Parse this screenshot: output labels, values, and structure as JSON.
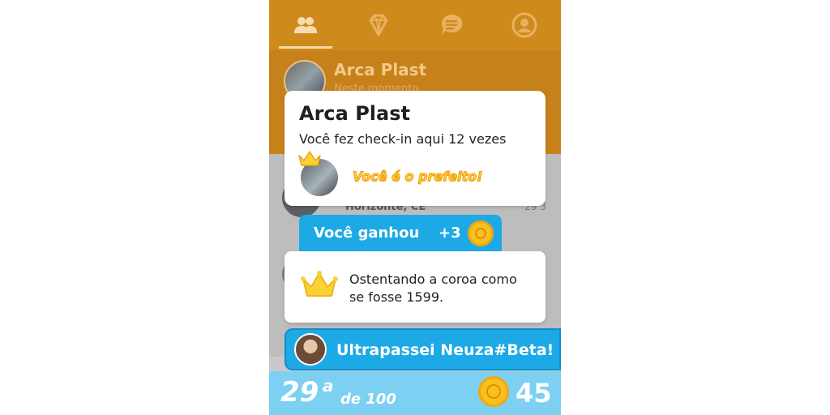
{
  "nav": {
    "tabs": [
      {
        "icon": "friends-icon",
        "active": true
      },
      {
        "icon": "diamond-icon",
        "active": false
      },
      {
        "icon": "chat-icon",
        "active": false
      },
      {
        "icon": "profile-icon",
        "active": false
      }
    ]
  },
  "venue": {
    "name": "Arca Plast",
    "subtitle": "Neste momento"
  },
  "background_list": {
    "location_text": "Horizonte, CE",
    "side_text": "29 3"
  },
  "checkin_card": {
    "title": "Arca Plast",
    "checkins_text": "Você fez check-in aqui 12 vezes",
    "mayor_text": "Você é o prefeito!"
  },
  "earned": {
    "label": "Você ganhou",
    "amount": "+3"
  },
  "badge_card": {
    "text": "Ostentando a coroa como se fosse 1599."
  },
  "overtake": {
    "text": "Ultrapassei Neuza#Beta!"
  },
  "rank": {
    "position": "29",
    "suffix": "a",
    "of_text": "de 100",
    "coins": "45"
  },
  "colors": {
    "nav_bg": "#cf8a1c",
    "accent_blue": "#1da9e6",
    "rank_bar": "#7dd0f2",
    "crown_yellow": "#f9d334"
  }
}
